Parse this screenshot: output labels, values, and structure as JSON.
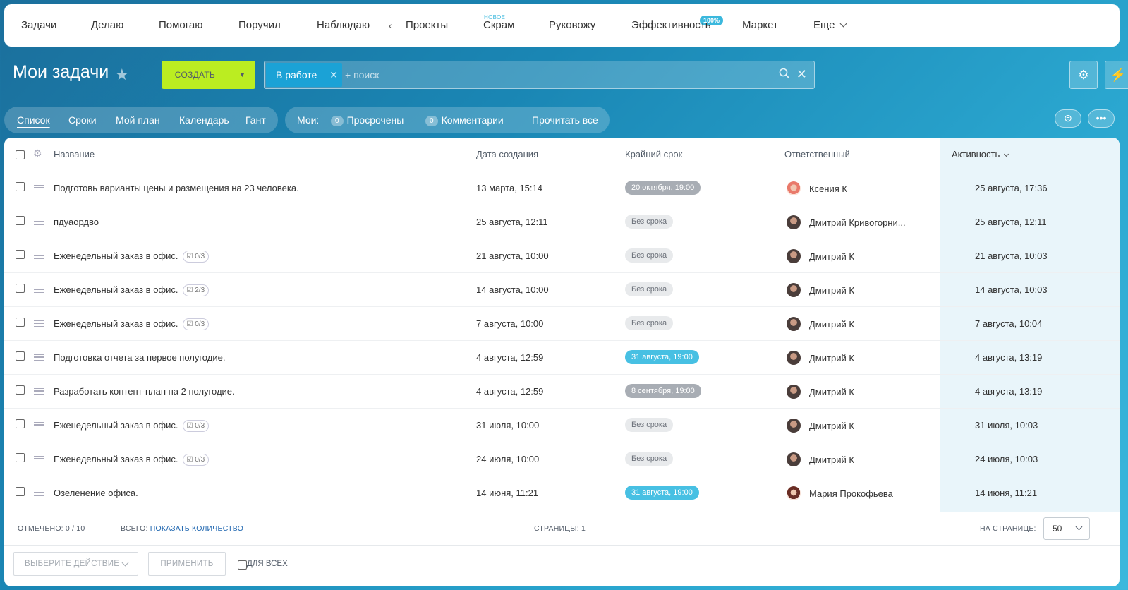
{
  "topnav": {
    "items": [
      "Задачи",
      "Делаю",
      "Помогаю",
      "Поручил",
      "Наблюдаю",
      "Проекты",
      "Скрам",
      "Руковожу",
      "Эффективность",
      "Маркет",
      "Еще"
    ],
    "scrum_badge": "НОВОЕ",
    "efficiency_badge": "100%"
  },
  "header": {
    "title": "Мои задачи",
    "create_label": "СОЗДАТЬ",
    "filter_tag": "В работе",
    "search_placeholder": "+ поиск"
  },
  "views": {
    "items": [
      "Список",
      "Сроки",
      "Мой план",
      "Календарь",
      "Гант"
    ],
    "active": "Список"
  },
  "counters": {
    "label": "Мои:",
    "overdue_count": "0",
    "overdue_label": "Просрочены",
    "comments_count": "0",
    "comments_label": "Комментарии",
    "read_all": "Прочитать все"
  },
  "grid": {
    "columns": [
      "Название",
      "Дата создания",
      "Крайний срок",
      "Ответственный",
      "Активность"
    ],
    "rows": [
      {
        "title": "Подготовь варианты цены и размещения на 23 человека.",
        "checklist": "",
        "created": "13 марта, 15:14",
        "deadline": "20 октября, 19:00",
        "deadline_type": "gray",
        "responsible": "Ксения К",
        "avatar": "woman",
        "activity": "25 августа, 17:36"
      },
      {
        "title": "пдуаордво",
        "checklist": "",
        "created": "25 августа, 12:11",
        "deadline": "Без срока",
        "deadline_type": "none",
        "responsible": "Дмитрий Кривогорни...",
        "avatar": "dark",
        "activity": "25 августа, 12:11"
      },
      {
        "title": "Еженедельный заказ в офис.",
        "checklist": "0/3",
        "created": "21 августа, 10:00",
        "deadline": "Без срока",
        "deadline_type": "none",
        "responsible": "Дмитрий К",
        "avatar": "dark",
        "activity": "21 августа, 10:03"
      },
      {
        "title": "Еженедельный заказ в офис.",
        "checklist": "2/3",
        "created": "14 августа, 10:00",
        "deadline": "Без срока",
        "deadline_type": "none",
        "responsible": "Дмитрий К",
        "avatar": "dark",
        "activity": "14 августа, 10:03"
      },
      {
        "title": "Еженедельный заказ в офис.",
        "checklist": "0/3",
        "created": "7 августа, 10:00",
        "deadline": "Без срока",
        "deadline_type": "none",
        "responsible": "Дмитрий К",
        "avatar": "dark",
        "activity": "7 августа, 10:04"
      },
      {
        "title": "Подготовка отчета за первое полугодие.",
        "checklist": "",
        "created": "4 августа, 12:59",
        "deadline": "31 августа, 19:00",
        "deadline_type": "blue",
        "responsible": "Дмитрий К",
        "avatar": "dark",
        "activity": "4 августа, 13:19"
      },
      {
        "title": "Разработать контент-план на 2 полугодие.",
        "checklist": "",
        "created": "4 августа, 12:59",
        "deadline": "8 сентября, 19:00",
        "deadline_type": "gray",
        "responsible": "Дмитрий К",
        "avatar": "dark",
        "activity": "4 августа, 13:19"
      },
      {
        "title": "Еженедельный заказ в офис.",
        "checklist": "0/3",
        "created": "31 июля, 10:00",
        "deadline": "Без срока",
        "deadline_type": "none",
        "responsible": "Дмитрий К",
        "avatar": "dark",
        "activity": "31 июля, 10:03"
      },
      {
        "title": "Еженедельный заказ в офис.",
        "checklist": "0/3",
        "created": "24 июля, 10:00",
        "deadline": "Без срока",
        "deadline_type": "none",
        "responsible": "Дмитрий К",
        "avatar": "dark",
        "activity": "24 июля, 10:03"
      },
      {
        "title": "Озеленение офиса.",
        "checklist": "",
        "created": "14 июня, 11:21",
        "deadline": "31 августа, 19:00",
        "deadline_type": "blue",
        "responsible": "Мария Прокофьева",
        "avatar": "woman2",
        "activity": "14 июня, 11:21"
      }
    ]
  },
  "footer": {
    "selected": "ОТМЕЧЕНО: 0 / 10",
    "total_label": "ВСЕГО:",
    "total_link": "ПОКАЗАТЬ КОЛИЧЕСТВО",
    "pages": "СТРАНИЦЫ: 1",
    "per_page_label": "НА СТРАНИЦЕ:",
    "per_page_value": "50",
    "action_select": "ВЫБЕРИТЕ ДЕЙСТВИЕ",
    "apply": "ПРИМЕНИТЬ",
    "for_all": "ДЛЯ ВСЕХ"
  },
  "colors": {
    "create_button": "#bbed21",
    "filter_tag": "#1ba2d6",
    "deadline_blue": "#47c0e3",
    "deadline_gray": "#a8adb4",
    "link": "#2067b0"
  }
}
